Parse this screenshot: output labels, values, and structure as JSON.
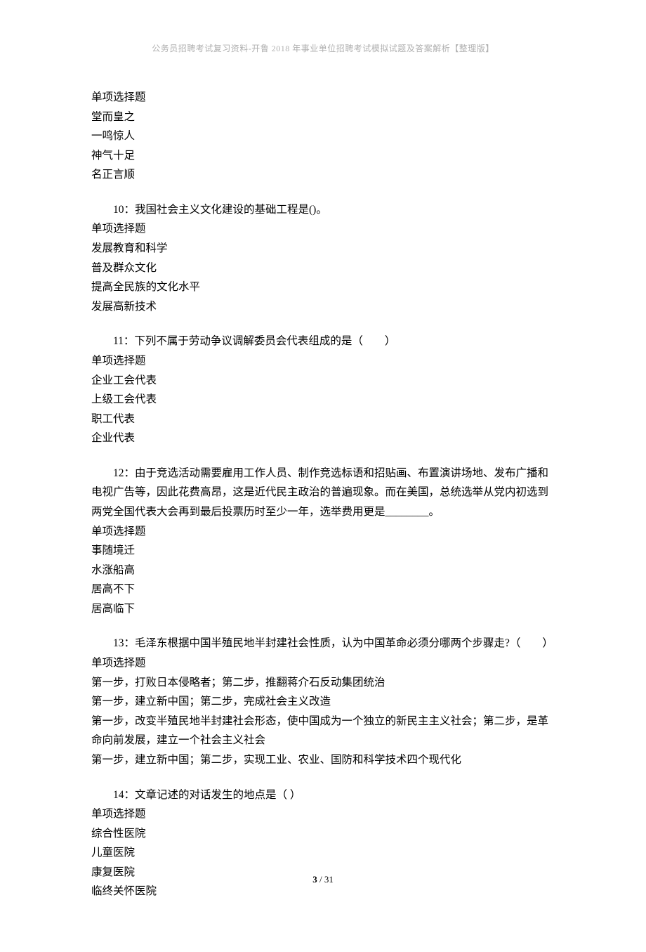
{
  "header": "公务员招聘考试复习资料-开鲁 2018 年事业单位招聘考试模拟试题及答案解析【整理版】",
  "q9": {
    "type": "单项选择题",
    "opts": [
      "堂而皇之",
      "一鸣惊人",
      "神气十足",
      "名正言顺"
    ]
  },
  "q10": {
    "label": "10：我国社会主义文化建设的基础工程是()。",
    "type": "单项选择题",
    "opts": [
      "发展教育和科学",
      "普及群众文化",
      "提高全民族的文化水平",
      "发展高新技术"
    ]
  },
  "q11": {
    "label": "11：下列不属于劳动争议调解委员会代表组成的是（　　）",
    "type": "单项选择题",
    "opts": [
      "企业工会代表",
      "上级工会代表",
      "职工代表",
      "企业代表"
    ]
  },
  "q12": {
    "label": "12：由于竞选活动需要雇用工作人员、制作竞选标语和招贴画、布置演讲场地、发布广播和电视广告等，因此花费高昂，这是近代民主政治的普遍现象。而在美国，总统选举从党内初选到两党全国代表大会再到最后投票历时至少一年，选举费用更是________。",
    "type": "单项选择题",
    "opts": [
      "事随境迁",
      "水涨船高",
      "居高不下",
      "居高临下"
    ]
  },
  "q13": {
    "label": "13：毛泽东根据中国半殖民地半封建社会性质，认为中国革命必须分哪两个步骤走?（　　）",
    "type": "单项选择题",
    "opts": [
      "第一步，打败日本侵略者；第二步，推翻蒋介石反动集团统治",
      "第一步，建立新中国；第二步，完成社会主义改造",
      "第一步，改变半殖民地半封建社会形态，使中国成为一个独立的新民主主义社会；第二步，是革命向前发展，建立一个社会主义社会",
      "第一步，建立新中国；第二步，实现工业、农业、国防和科学技术四个现代化"
    ]
  },
  "q14": {
    "label": "14：文章记述的对话发生的地点是（ ）",
    "type": "单项选择题",
    "opts": [
      "综合性医院",
      "儿童医院",
      "康复医院",
      "临终关怀医院"
    ]
  },
  "footer": {
    "current": "3",
    "sep": " / ",
    "total": "31"
  }
}
